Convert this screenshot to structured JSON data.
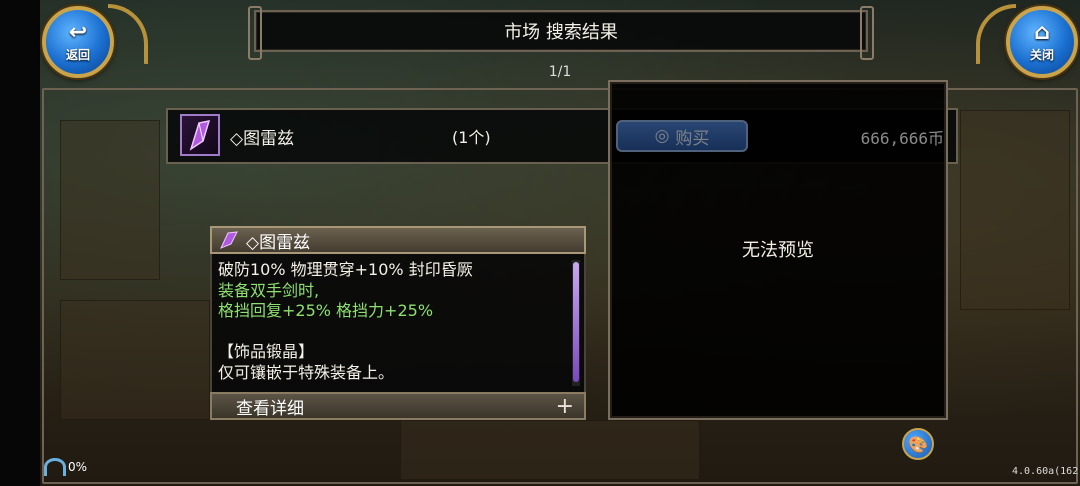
{
  "header": {
    "back_label": "返回",
    "close_label": "关闭",
    "title": "市场 搜索结果",
    "page_indicator": "1/1"
  },
  "result": {
    "item_name": "◇图雷兹",
    "quantity": "(1个)",
    "buy_label": "购买",
    "price": "666,666币"
  },
  "preview": {
    "message": "无法预览"
  },
  "tooltip": {
    "title": "◇图雷兹",
    "lines": [
      {
        "text": "破防10% 物理贯穿+10% 封印昏厥",
        "color": "white"
      },
      {
        "text": "装备双手剑时,",
        "color": "green"
      },
      {
        "text": "格挡回复+25% 格挡力+25%",
        "color": "green"
      },
      {
        "text": "",
        "color": "white"
      },
      {
        "text": "【饰品锻晶】",
        "color": "white"
      },
      {
        "text": "仅可镶嵌于特殊装备上。",
        "color": "white"
      }
    ],
    "details_label": "查看详细"
  },
  "status": {
    "signal_percent": "0%",
    "version": "4.0.60a(162)"
  },
  "icons": {
    "back": "back-arrow-icon",
    "close": "home-icon",
    "item": "purple-crystal-icon",
    "buy": "coin-bag-icon",
    "palette": "palette-icon",
    "signal": "signal-icon"
  },
  "colors": {
    "accent_gold": "#c9a44a",
    "button_blue": "#1a6fd0",
    "green_text": "#8ee070"
  }
}
